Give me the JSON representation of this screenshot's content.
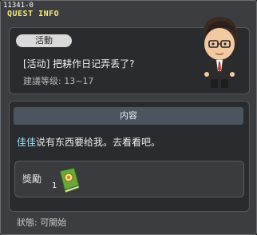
{
  "window": {
    "id_text": "11341-0",
    "title": "QUEST INFO"
  },
  "quest": {
    "tag": "活動",
    "title": "[活动] 把耕作日记弄丢了?",
    "level_label": "建議等级: 13~17"
  },
  "content": {
    "header": "内容",
    "desc_highlight": "佳佳",
    "desc_rest": "说有东西要给我。去看看吧。"
  },
  "reward": {
    "label": "獎勵",
    "item_icon": "diary-book-icon",
    "count": "1"
  },
  "status": {
    "label": "狀態: 可開始"
  }
}
